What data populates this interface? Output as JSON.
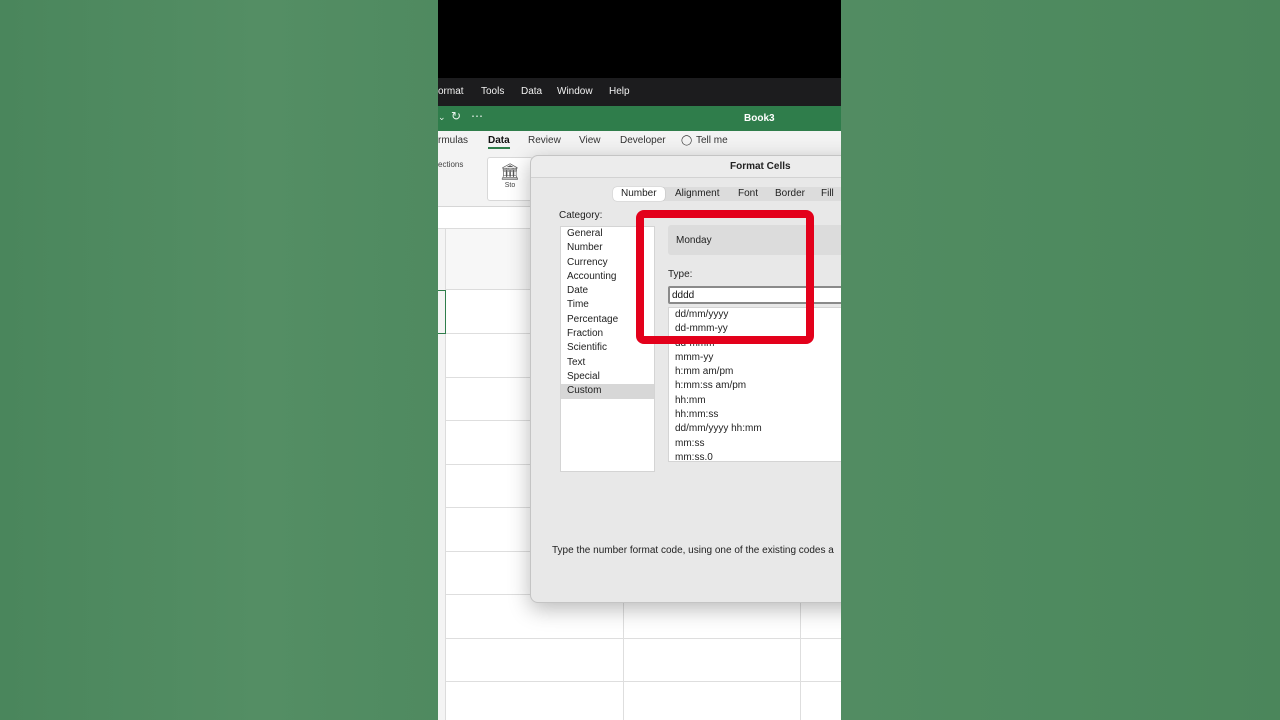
{
  "menubar": {
    "items": [
      "ormat",
      "Tools",
      "Data",
      "Window",
      "Help"
    ]
  },
  "titlebar": {
    "qa_icons": [
      "chevron-down-icon",
      "redo-icon",
      "more-icon"
    ],
    "book_title": "Book3",
    "accent_color": "#2f7d4b"
  },
  "ribbon": {
    "tabs": [
      "rmulas",
      "Data",
      "Review",
      "View",
      "Developer",
      "Tell me"
    ],
    "active_tab": "Data",
    "connections_label": "ections",
    "stocks_label": "Sto"
  },
  "dialog": {
    "title": "Format Cells",
    "tabs": [
      "Number",
      "Alignment",
      "Font",
      "Border",
      "Fill"
    ],
    "active_tab": "Number",
    "category_label": "Category:",
    "categories": [
      "General",
      "Number",
      "Currency",
      "Accounting",
      "Date",
      "Time",
      "Percentage",
      "Fraction",
      "Scientific",
      "Text",
      "Special",
      "Custom"
    ],
    "selected_category": "Custom",
    "sample_value": "Monday",
    "type_label": "Type:",
    "type_value": "dddd",
    "type_options": [
      "dd/mm/yyyy",
      "dd-mmm-yy",
      "dd-mmm",
      "mmm-yy",
      "h:mm am/pm",
      "h:mm:ss am/pm",
      "hh:mm",
      "hh:mm:ss",
      "dd/mm/yyyy hh:mm",
      "mm:ss",
      "mm:ss.0"
    ],
    "hint_text": "Type the number format code, using one of the existing codes a"
  },
  "highlight_color": "#e3001b"
}
